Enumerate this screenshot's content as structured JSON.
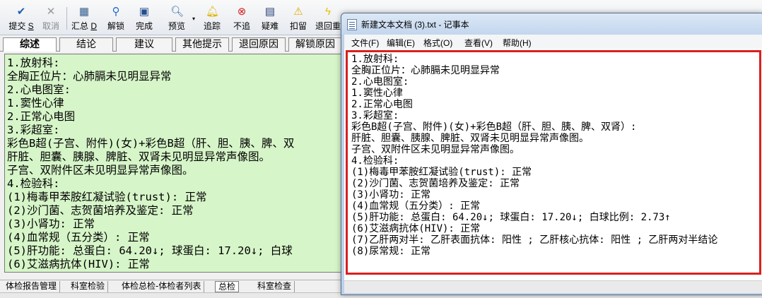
{
  "toolbar": {
    "buttons": [
      {
        "label": "提交",
        "shortcut": "S",
        "icon": "check-icon"
      },
      {
        "label": "取消",
        "icon": "x-icon"
      },
      {
        "label": "汇总",
        "shortcut": "D",
        "icon": "calculator-icon"
      },
      {
        "label": "解锁",
        "icon": "pin-icon"
      },
      {
        "label": "完成",
        "icon": "save-icon"
      },
      {
        "label": "预览",
        "icon": "preview-icon"
      },
      {
        "label": "追踪",
        "icon": "bell-icon"
      },
      {
        "label": "不追",
        "icon": "stop-icon"
      },
      {
        "label": "疑难",
        "icon": "book-icon"
      },
      {
        "label": "扣留",
        "icon": "warning-icon"
      },
      {
        "label": "退回重",
        "icon": "lightning-icon"
      }
    ]
  },
  "tabs": [
    "综述",
    "结论",
    "建议",
    "其他提示",
    "退回原因",
    "解锁原因"
  ],
  "summary_lines": [
    "1.放射科:",
    "全胸正位片：心肺膈未见明显异常",
    "2.心电图室:",
    "1.窦性心律",
    "2.正常心电图",
    "3.彩超室:",
    "彩色B超(子宫、附件)(女)+彩色B超（肝、胆、胰、脾、双",
    "肝脏、胆囊、胰腺、脾脏、双肾未见明显异常声像图。",
    "子宫、双附件区未见明显异常声像图。",
    "4.检验科:",
    "(1)梅毒甲苯胺红凝试验(trust): 正常",
    "(2)沙门菌、志贺菌培养及鉴定: 正常",
    "(3)小肾功: 正常",
    "(4)血常规（五分类）: 正常",
    "(5)肝功能: 总蛋白: 64.20↓; 球蛋白: 17.20↓; 白球",
    "(6)艾滋病抗体(HIV): 正常"
  ],
  "bottom_tabs": [
    "体检报告管理",
    "科室检验",
    "体检总检-体检者列表",
    "总检",
    "科室检查"
  ],
  "notepad": {
    "title": "新建文本文档 (3).txt - 记事本",
    "menu": [
      "文件(F)",
      "编辑(E)",
      "格式(O)",
      "查看(V)",
      "帮助(H)"
    ],
    "lines": [
      "1.放射科:",
      " 全胸正位片：心肺膈未见明显异常",
      "2.心电图室:",
      " 1.窦性心律",
      " 2.正常心电图",
      "3.彩超室:",
      " 彩色B超(子宫、附件)(女)+彩色B超（肝、胆、胰、脾、双肾）:",
      " 肝脏、胆囊、胰腺、脾脏、双肾未见明显异常声像图。",
      " 子宫、双附件区未见明显异常声像图。",
      "4.检验科:",
      " (1)梅毒甲苯胺红凝试验(trust): 正常",
      " (2)沙门菌、志贺菌培养及鉴定: 正常",
      " (3)小肾功: 正常",
      " (4)血常规（五分类）: 正常",
      " (5)肝功能: 总蛋白: 64.20↓; 球蛋白: 17.20↓; 白球比例: 2.73↑",
      " (6)艾滋病抗体(HIV): 正常",
      " (7)乙肝两对半: 乙肝表面抗体: 阳性 ; 乙肝核心抗体: 阳性 ; 乙肝两对半结论",
      " (8)尿常规: 正常"
    ]
  },
  "colors": {
    "summary_bg": "#d6f5c8",
    "highlight_border": "#d9201f"
  }
}
